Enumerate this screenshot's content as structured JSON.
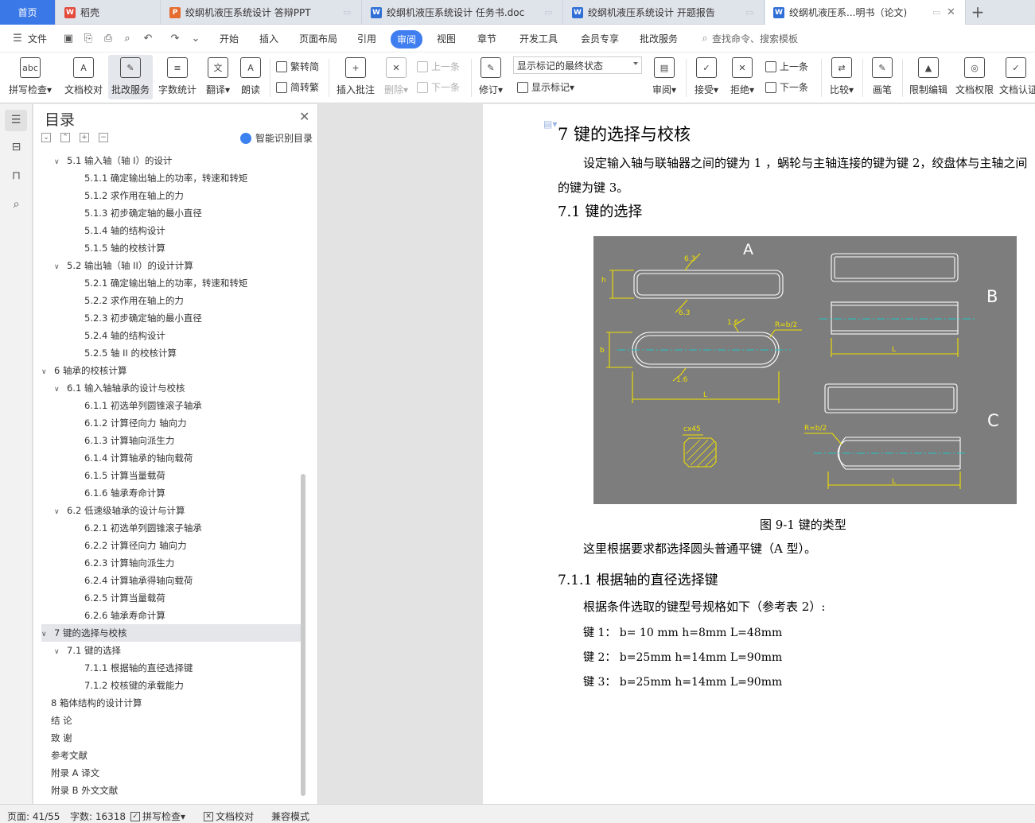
{
  "tabs": [
    {
      "label": "首页",
      "kind": "home"
    },
    {
      "label": "稻壳",
      "icon": "docer-icon"
    },
    {
      "label": "绞纲机液压系统设计 答辩PPT",
      "icon": "ppt-icon"
    },
    {
      "label": "绞纲机液压系统设计 任务书.doc",
      "icon": "word-icon"
    },
    {
      "label": "绞纲机液压系统设计 开题报告",
      "icon": "word-icon"
    },
    {
      "label": "绞纲机液压系...明书（论文)",
      "icon": "word-icon"
    }
  ],
  "menu": {
    "file": "文件",
    "items": [
      "开始",
      "插入",
      "页面布局",
      "引用",
      "审阅",
      "视图",
      "章节",
      "开发工具",
      "会员专享",
      "批改服务"
    ],
    "active": "审阅",
    "search_placeholder": "查找命令、搜索模板"
  },
  "ribbon": {
    "spell": "拼写检查",
    "proof": "文档校对",
    "grading": "批改服务",
    "wordcount": "字数统计",
    "translate": "翻译",
    "read": "朗读",
    "trad": "繁转简",
    "simp": "简转繁",
    "insert_comment": "插入批注",
    "delete": "删除",
    "prev_comment": "上一条",
    "next_comment": "下一条",
    "revise": "修订",
    "markup_state": "显示标记的最终状态",
    "show_markup": "显示标记",
    "review": "审阅",
    "accept": "接受",
    "reject": "拒绝",
    "prev": "上一条",
    "next": "下一条",
    "compare": "比较",
    "pen": "画笔",
    "restrict": "限制编辑",
    "permission": "文档权限",
    "certify": "文档认证"
  },
  "nav": {
    "title": "目录",
    "smart": "智能识别目录",
    "toc": [
      {
        "level": 2,
        "text": "5.1  输入轴（轴 I）的设计",
        "arrow": "v"
      },
      {
        "level": 3,
        "text": "5.1.1  确定输出轴上的功率，转速和转矩"
      },
      {
        "level": 3,
        "text": "5.1.2   求作用在轴上的力"
      },
      {
        "level": 3,
        "text": "5.1.3  初步确定轴的最小直径"
      },
      {
        "level": 3,
        "text": "5.1.4  轴的结构设计"
      },
      {
        "level": 3,
        "text": "5.1.5  轴的校核计算"
      },
      {
        "level": 2,
        "text": "5.2  输出轴（轴 II）的设计计算",
        "arrow": "v"
      },
      {
        "level": 3,
        "text": "5.2.1  确定输出轴上的功率，转速和转矩"
      },
      {
        "level": 3,
        "text": "5.2.2  求作用在轴上的力"
      },
      {
        "level": 3,
        "text": "5.2.3  初步确定轴的最小直径"
      },
      {
        "level": 3,
        "text": "5.2.4  轴的结构设计"
      },
      {
        "level": 3,
        "text": "5.2.5  轴 II 的校核计算"
      },
      {
        "level": 1,
        "text": "6  轴承的校核计算",
        "arrow": "v"
      },
      {
        "level": 2,
        "text": "6.1  输入轴轴承的设计与校核",
        "arrow": "v"
      },
      {
        "level": 3,
        "text": "6.1.1  初选单列圆锥滚子轴承"
      },
      {
        "level": 3,
        "text": "6.1.2  计算径向力    轴向力"
      },
      {
        "level": 3,
        "text": "6.1.3  计算轴向派生力"
      },
      {
        "level": 3,
        "text": "6.1.4  计算轴承的轴向载荷"
      },
      {
        "level": 3,
        "text": "6.1.5  计算当量载荷"
      },
      {
        "level": 3,
        "text": "6.1.6  轴承寿命计算"
      },
      {
        "level": 2,
        "text": "6.2  低速级轴承的设计与计算",
        "arrow": "v"
      },
      {
        "level": 3,
        "text": "6.2.1  初选单列圆锥滚子轴承"
      },
      {
        "level": 3,
        "text": "6.2.2  计算径向力      轴向力"
      },
      {
        "level": 3,
        "text": "6.2.3  计算轴向派生力"
      },
      {
        "level": 3,
        "text": "6.2.4  计算轴承得轴向载荷"
      },
      {
        "level": 3,
        "text": "6.2.5  计算当量载荷"
      },
      {
        "level": 3,
        "text": "6.2.6  轴承寿命计算"
      },
      {
        "level": 1,
        "text": "7  键的选择与校核",
        "arrow": "v",
        "selected": true
      },
      {
        "level": 2,
        "text": "7.1  键的选择",
        "arrow": "v"
      },
      {
        "level": 3,
        "text": "7.1.1  根据轴的直径选择键"
      },
      {
        "level": 3,
        "text": "7.1.2  校核键的承载能力"
      },
      {
        "level": 1,
        "text": "8  箱体结构的设计计算"
      },
      {
        "level": 1,
        "text": "结    论"
      },
      {
        "level": 1,
        "text": "致    谢"
      },
      {
        "level": 1,
        "text": "参考文献"
      },
      {
        "level": 1,
        "text": "附录 A  译文"
      },
      {
        "level": 1,
        "text": "附录 B  外文文献"
      }
    ]
  },
  "doc": {
    "h1": "7  键的选择与校核",
    "p1": "设定输入轴与联轴器之间的键为 1 ，蜗轮与主轴连接的键为键 2，绞盘体与主轴之间",
    "p1b": "的键为键 3。",
    "h2": "7.1  键的选择",
    "figure": {
      "labels": {
        "A": "A",
        "B": "B",
        "C": "C",
        "r1": "6.3",
        "r2": "6.3",
        "r3": "1.6",
        "r4": "1.6",
        "R1": "R=b/2",
        "R2": "R=b/2",
        "h": "h",
        "b": "b",
        "L1": "L",
        "L2": "L",
        "L3": "L",
        "cx45": "cx45"
      }
    },
    "caption": "图  9-1  键的类型",
    "p2": "这里根据要求都选择圆头普通平键（A 型）。",
    "h3": "7.1.1  根据轴的直径选择键",
    "p3": "根据条件选取的键型号规格如下（参考表 2）:",
    "k1": "键 1：    b= 10 mm    h=8mm    L=48mm",
    "k2": "键 2：    b=25mm    h=14mm    L=90mm",
    "k3": "键 3：    b=25mm    h=14mm    L=90mm"
  },
  "status": {
    "page": "页面: 41/55",
    "words": "字数: 16318",
    "spell": "拼写检查",
    "proof": "文档校对",
    "compat": "兼容模式"
  },
  "colors": {
    "accent": "#3f7ef0",
    "home_tab": "#3b78e7",
    "figure_bg": "#7d7d7d",
    "figure_line": "#ffffff",
    "figure_dim": "#f0e000",
    "figure_center": "#21c5c5"
  }
}
